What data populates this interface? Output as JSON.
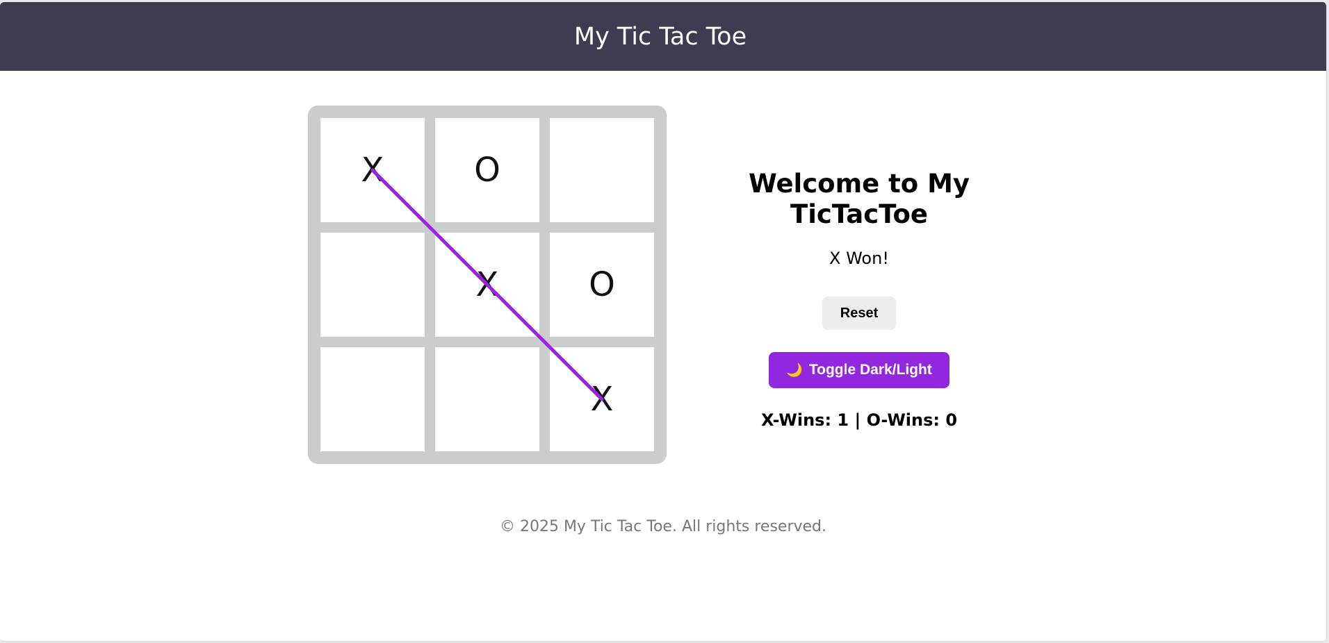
{
  "header": {
    "title": "My Tic Tac Toe"
  },
  "board": {
    "cells": [
      "X",
      "O",
      "",
      "",
      "X",
      "O",
      "",
      "",
      "X"
    ],
    "win_line": {
      "from_cell": 0,
      "to_cell": 8
    },
    "line_color": "#9327e0"
  },
  "panel": {
    "title": "Welcome to My TicTacToe",
    "status": "X Won!",
    "reset_label": "Reset",
    "toggle_icon": "🌙",
    "toggle_label": "Toggle Dark/Light",
    "score": "X-Wins: 1 | O-Wins: 0"
  },
  "footer": {
    "text": "© 2025 My Tic Tac Toe. All rights reserved."
  },
  "colors": {
    "header_bg": "#3e3c50",
    "board_bg": "#cccccc",
    "accent": "#9327e0",
    "reset_bg": "#eeeeee"
  }
}
